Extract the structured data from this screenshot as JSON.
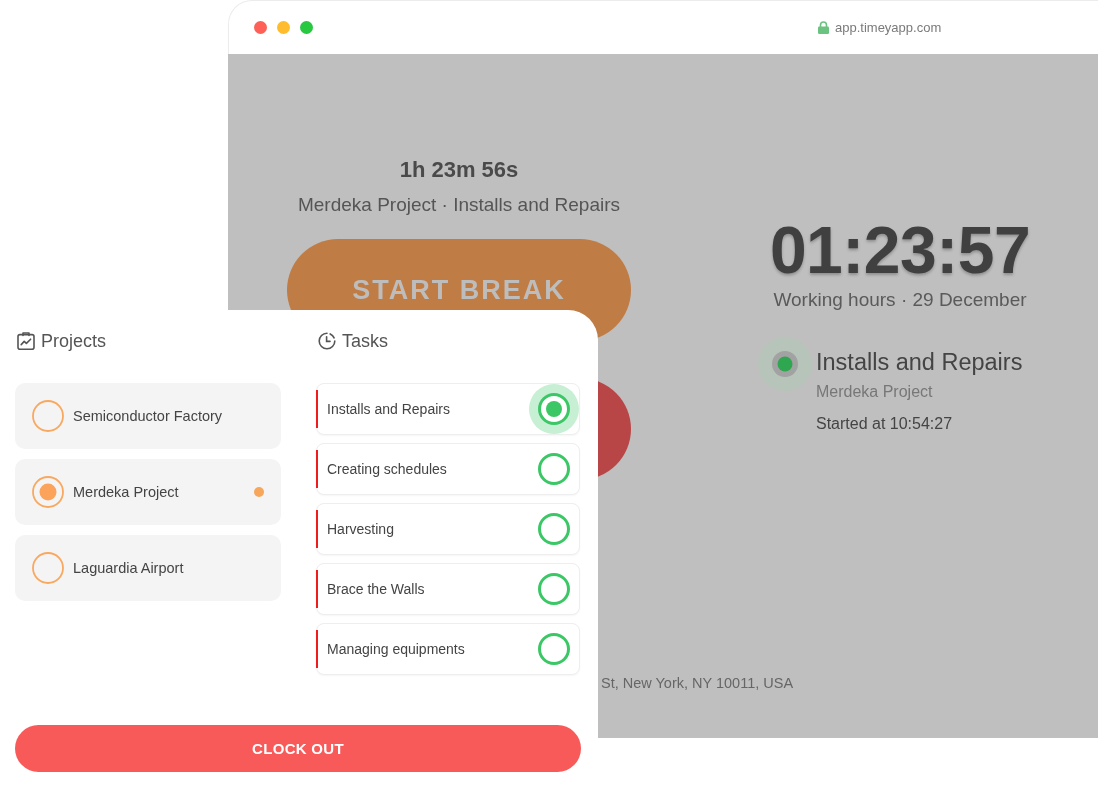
{
  "browser": {
    "url": "app.timeyapp.com"
  },
  "timer_screen": {
    "elapsed": "1h 23m 56s",
    "context": "Merdeka Project · Installs and Repairs",
    "start_break_button": "START BREAK",
    "clock": "01:23:57",
    "clock_caption": "Working hours · 29 December",
    "current_task": {
      "name": "Installs and Repairs",
      "project": "Merdeka Project",
      "started": "Started at 10:54:27"
    },
    "address": "St, New York, NY 10011, USA"
  },
  "panel": {
    "projects": {
      "title": "Projects",
      "items": [
        {
          "name": "Semiconductor Factory",
          "selected": false,
          "running": false
        },
        {
          "name": "Merdeka Project",
          "selected": true,
          "running": true
        },
        {
          "name": "Laguardia Airport",
          "selected": false,
          "running": false
        }
      ]
    },
    "tasks": {
      "title": "Tasks",
      "items": [
        {
          "name": "Installs and Repairs",
          "selected": true
        },
        {
          "name": "Creating schedules",
          "selected": false
        },
        {
          "name": "Harvesting",
          "selected": false
        },
        {
          "name": "Brace the Walls",
          "selected": false
        },
        {
          "name": "Managing equipments",
          "selected": false
        }
      ]
    },
    "clock_out_button": "CLOCK OUT"
  }
}
